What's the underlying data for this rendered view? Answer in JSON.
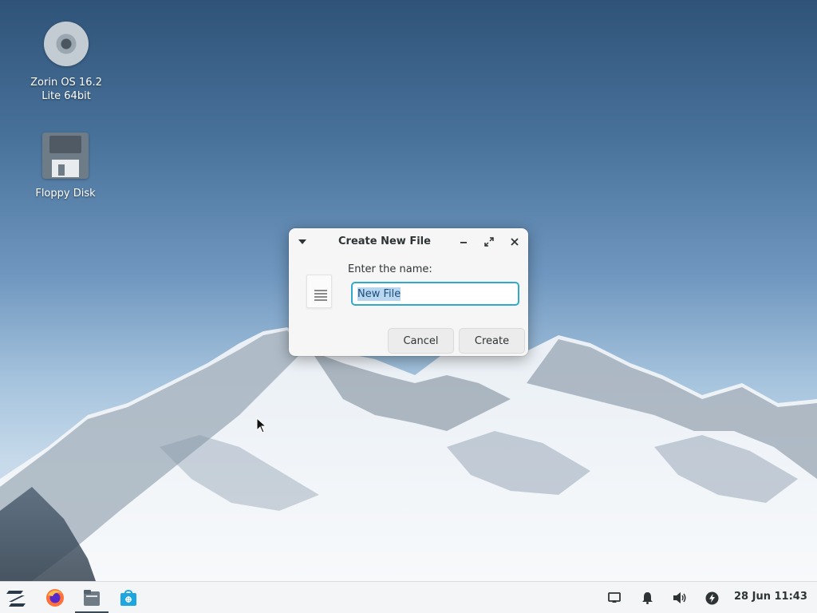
{
  "desktop": {
    "icons": [
      {
        "label": "Zorin OS 16.2 Lite 64bit",
        "icon": "optical-disc-icon"
      },
      {
        "label": "Floppy Disk",
        "icon": "floppy-disk-icon"
      }
    ]
  },
  "dialog": {
    "title": "Create New File",
    "prompt": "Enter the name:",
    "input_value": "New File",
    "cancel_label": "Cancel",
    "create_label": "Create",
    "file_icon": "text-file-icon",
    "focus_color": "#31a9c8"
  },
  "taskbar": {
    "apps": [
      {
        "name": "Zorin menu",
        "icon": "zorin-logo-icon"
      },
      {
        "name": "Firefox",
        "icon": "firefox-icon"
      },
      {
        "name": "Files",
        "icon": "files-icon",
        "active": true
      },
      {
        "name": "Software",
        "icon": "software-store-icon"
      }
    ],
    "tray_icons": [
      "screen-icon",
      "bell-icon",
      "volume-icon",
      "power-icon"
    ],
    "clock": "28 Jun 11:43"
  }
}
